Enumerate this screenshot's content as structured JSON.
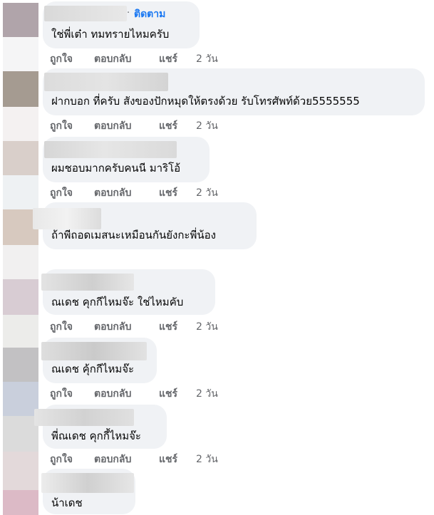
{
  "follow_label": "ติดตาม",
  "follow_separator": "·",
  "actions": {
    "like": "ถูกใจ",
    "reply": "ตอบกลับ",
    "share": "แชร์"
  },
  "comments": [
    {
      "text": "ใช่พี่เต๋า ทมทรายไหมครับ",
      "time": "2 วัน"
    },
    {
      "text": "ฝากบอก ที่ครับ สังของปักหมุดให้ตรงด้วย รับโทรศัพท์ด้วย5555555",
      "time": "2 วัน"
    },
    {
      "text": "ผมชอบมากครับคนนี มาริโอ้",
      "time": "2 วัน"
    },
    {
      "text": "ถ้าพีถอดเมสนะเหมือนกันยังกะพี่น้อง"
    },
    {
      "text": "ณเดช คุกกีไหมจ๊ะ ใช่ไหมคับ",
      "time": "2 วัน"
    },
    {
      "text": "ณเดช คุ้กกีไหมจ๊ะ",
      "time": "2 วัน"
    },
    {
      "text": "พี่ณเดช คุกกี้ไหมจ๊ะ",
      "time": "2 วัน"
    },
    {
      "text": "น้าเดช"
    }
  ]
}
